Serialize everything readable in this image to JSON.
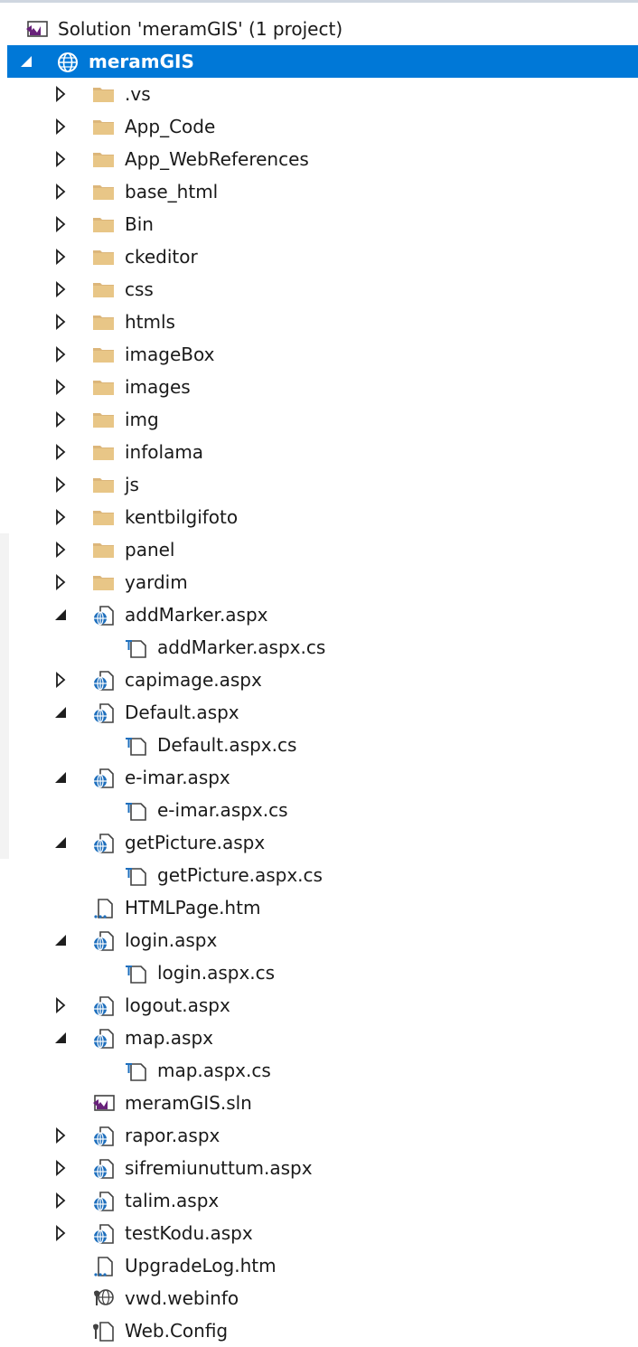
{
  "tree": [
    {
      "label": "Solution 'meramGIS' (1 project)",
      "icon": "solution-icon",
      "level": 0,
      "expander": "none"
    },
    {
      "label": "meramGIS",
      "icon": "web-project-globe-icon",
      "level": 0,
      "expander": "expanded",
      "selected": true
    },
    {
      "label": ".vs",
      "icon": "folder-icon",
      "level": 1,
      "expander": "collapsed"
    },
    {
      "label": "App_Code",
      "icon": "folder-icon",
      "level": 1,
      "expander": "collapsed"
    },
    {
      "label": "App_WebReferences",
      "icon": "folder-icon",
      "level": 1,
      "expander": "collapsed"
    },
    {
      "label": "base_html",
      "icon": "folder-icon",
      "level": 1,
      "expander": "collapsed"
    },
    {
      "label": "Bin",
      "icon": "folder-icon",
      "level": 1,
      "expander": "collapsed"
    },
    {
      "label": "ckeditor",
      "icon": "folder-icon",
      "level": 1,
      "expander": "collapsed"
    },
    {
      "label": "css",
      "icon": "folder-icon",
      "level": 1,
      "expander": "collapsed"
    },
    {
      "label": "htmls",
      "icon": "folder-icon",
      "level": 1,
      "expander": "collapsed"
    },
    {
      "label": "imageBox",
      "icon": "folder-icon",
      "level": 1,
      "expander": "collapsed"
    },
    {
      "label": "images",
      "icon": "folder-icon",
      "level": 1,
      "expander": "collapsed"
    },
    {
      "label": "img",
      "icon": "folder-icon",
      "level": 1,
      "expander": "collapsed"
    },
    {
      "label": "infolama",
      "icon": "folder-icon",
      "level": 1,
      "expander": "collapsed"
    },
    {
      "label": "js",
      "icon": "folder-icon",
      "level": 1,
      "expander": "collapsed"
    },
    {
      "label": "kentbilgifoto",
      "icon": "folder-icon",
      "level": 1,
      "expander": "collapsed"
    },
    {
      "label": "panel",
      "icon": "folder-icon",
      "level": 1,
      "expander": "collapsed"
    },
    {
      "label": "yardim",
      "icon": "folder-icon",
      "level": 1,
      "expander": "collapsed"
    },
    {
      "label": "addMarker.aspx",
      "icon": "aspx-page-icon",
      "level": 1,
      "expander": "expanded"
    },
    {
      "label": "addMarker.aspx.cs",
      "icon": "cs-code-file-icon",
      "level": 2,
      "expander": "none"
    },
    {
      "label": "capimage.aspx",
      "icon": "aspx-page-icon",
      "level": 1,
      "expander": "collapsed"
    },
    {
      "label": "Default.aspx",
      "icon": "aspx-page-icon",
      "level": 1,
      "expander": "expanded"
    },
    {
      "label": "Default.aspx.cs",
      "icon": "cs-code-file-icon",
      "level": 2,
      "expander": "none"
    },
    {
      "label": "e-imar.aspx",
      "icon": "aspx-page-icon",
      "level": 1,
      "expander": "expanded"
    },
    {
      "label": "e-imar.aspx.cs",
      "icon": "cs-code-file-icon",
      "level": 2,
      "expander": "none"
    },
    {
      "label": "getPicture.aspx",
      "icon": "aspx-page-icon",
      "level": 1,
      "expander": "expanded"
    },
    {
      "label": "getPicture.aspx.cs",
      "icon": "cs-code-file-icon",
      "level": 2,
      "expander": "none"
    },
    {
      "label": "HTMLPage.htm",
      "icon": "html-file-icon",
      "level": 1,
      "expander": "none"
    },
    {
      "label": "login.aspx",
      "icon": "aspx-page-icon",
      "level": 1,
      "expander": "expanded"
    },
    {
      "label": "login.aspx.cs",
      "icon": "cs-code-file-icon",
      "level": 2,
      "expander": "none"
    },
    {
      "label": "logout.aspx",
      "icon": "aspx-page-icon",
      "level": 1,
      "expander": "collapsed"
    },
    {
      "label": "map.aspx",
      "icon": "aspx-page-icon",
      "level": 1,
      "expander": "expanded"
    },
    {
      "label": "map.aspx.cs",
      "icon": "cs-code-file-icon",
      "level": 2,
      "expander": "none"
    },
    {
      "label": "meramGIS.sln",
      "icon": "solution-icon",
      "level": 1,
      "expander": "none"
    },
    {
      "label": "rapor.aspx",
      "icon": "aspx-page-icon",
      "level": 1,
      "expander": "collapsed"
    },
    {
      "label": "sifremiunuttum.aspx",
      "icon": "aspx-page-icon",
      "level": 1,
      "expander": "collapsed"
    },
    {
      "label": "talim.aspx",
      "icon": "aspx-page-icon",
      "level": 1,
      "expander": "collapsed"
    },
    {
      "label": "testKodu.aspx",
      "icon": "aspx-page-icon",
      "level": 1,
      "expander": "collapsed"
    },
    {
      "label": "UpgradeLog.htm",
      "icon": "html-file-icon",
      "level": 1,
      "expander": "none"
    },
    {
      "label": "vwd.webinfo",
      "icon": "webinfo-config-icon",
      "level": 1,
      "expander": "none"
    },
    {
      "label": "Web.Config",
      "icon": "config-file-icon",
      "level": 1,
      "expander": "none"
    }
  ],
  "colors": {
    "selection": "#0078d7",
    "folder": "#dcb67a",
    "globe": "#1e6fbd",
    "vs_purple": "#68217a",
    "text": "#1a1a1a"
  }
}
